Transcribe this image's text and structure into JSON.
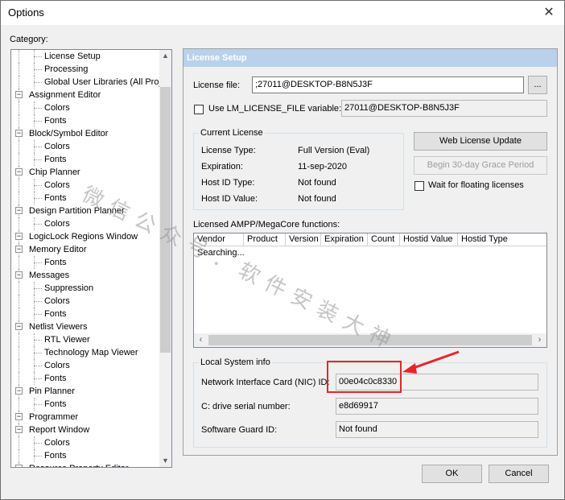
{
  "window": {
    "title": "Options",
    "close_glyph": "✕"
  },
  "category_label": "Category:",
  "tree": [
    {
      "label": "License Setup",
      "level": 1
    },
    {
      "label": "Processing",
      "level": 1
    },
    {
      "label": "Global User Libraries (All Proje",
      "level": 1
    },
    {
      "label": "Assignment Editor",
      "level": 0
    },
    {
      "label": "Colors",
      "level": 1
    },
    {
      "label": "Fonts",
      "level": 1
    },
    {
      "label": "Block/Symbol Editor",
      "level": 0
    },
    {
      "label": "Colors",
      "level": 1
    },
    {
      "label": "Fonts",
      "level": 1
    },
    {
      "label": "Chip Planner",
      "level": 0
    },
    {
      "label": "Colors",
      "level": 1
    },
    {
      "label": "Fonts",
      "level": 1
    },
    {
      "label": "Design Partition Planner",
      "level": 0
    },
    {
      "label": "Colors",
      "level": 1
    },
    {
      "label": "LogicLock Regions Window",
      "level": 0
    },
    {
      "label": "Memory Editor",
      "level": 0
    },
    {
      "label": "Fonts",
      "level": 1
    },
    {
      "label": "Messages",
      "level": 0
    },
    {
      "label": "Suppression",
      "level": 1
    },
    {
      "label": "Colors",
      "level": 1
    },
    {
      "label": "Fonts",
      "level": 1
    },
    {
      "label": "Netlist Viewers",
      "level": 0
    },
    {
      "label": "RTL Viewer",
      "level": 1
    },
    {
      "label": "Technology Map Viewer",
      "level": 1
    },
    {
      "label": "Colors",
      "level": 1
    },
    {
      "label": "Fonts",
      "level": 1
    },
    {
      "label": "Pin Planner",
      "level": 0
    },
    {
      "label": "Fonts",
      "level": 1
    },
    {
      "label": "Programmer",
      "level": 0
    },
    {
      "label": "Report Window",
      "level": 0
    },
    {
      "label": "Colors",
      "level": 1
    },
    {
      "label": "Fonts",
      "level": 1
    },
    {
      "label": "Resource Property Editor",
      "level": 0
    }
  ],
  "panel": {
    "header": "License Setup",
    "license_file_label": "License file:",
    "license_file_value": ";27011@DESKTOP-B8N5J3F",
    "browse_label": "...",
    "use_lm_label": "Use LM_LICENSE_FILE variable:",
    "use_lm_value": "27011@DESKTOP-B8N5J3F",
    "current_license": {
      "title": "Current License",
      "rows": [
        {
          "label": "License Type:",
          "value": "Full Version (Eval)"
        },
        {
          "label": "Expiration:",
          "value": "11-sep-2020"
        },
        {
          "label": "Host ID Type:",
          "value": "Not found"
        },
        {
          "label": "Host ID Value:",
          "value": "Not found"
        }
      ]
    },
    "web_license_update": "Web License Update",
    "grace_period": "Begin 30-day Grace Period",
    "wait_floating": "Wait for floating licenses",
    "licensed_label": "Licensed AMPP/MegaCore functions:",
    "table": {
      "columns": [
        "Vendor",
        "Product",
        "Version",
        "Expiration",
        "Count",
        "Hostid Value",
        "Hostid Type"
      ],
      "status": "Searching..."
    },
    "local_system": {
      "title": "Local System info",
      "nic_label": "Network Interface Card (NIC) ID:",
      "nic_value": "00e04c0c8330",
      "drive_label": "C: drive serial number:",
      "drive_value": "e8d69917",
      "guard_label": "Software Guard ID:",
      "guard_value": "Not found"
    }
  },
  "buttons": {
    "ok": "OK",
    "cancel": "Cancel"
  },
  "watermark": "微信公众号：软件安装大神",
  "colors": {
    "header_bg": "#b9d1ea",
    "highlight": "#e4262c"
  }
}
